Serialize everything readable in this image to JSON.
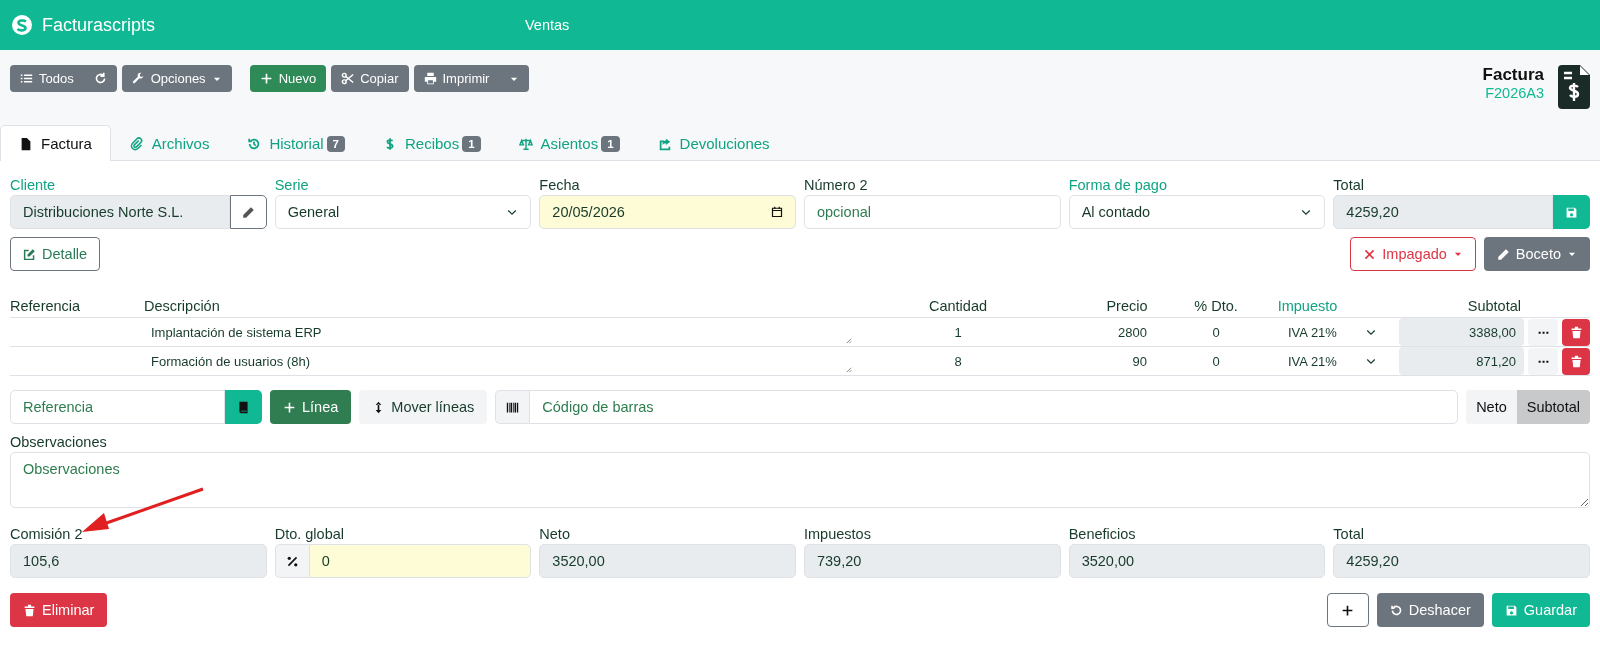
{
  "app": {
    "name": "Facturascripts",
    "section": "Ventas"
  },
  "toolbar": {
    "all": "Todos",
    "options": "Opciones",
    "new": "Nuevo",
    "copy": "Copiar",
    "print": "Imprimir"
  },
  "document": {
    "type": "Factura",
    "code": "F2026A3"
  },
  "tabs": [
    {
      "label": "Factura",
      "selected": true
    },
    {
      "label": "Archivos",
      "selected": false
    },
    {
      "label": "Historial",
      "badge": "7",
      "selected": false
    },
    {
      "label": "Recibos",
      "badge": "1",
      "selected": false
    },
    {
      "label": "Asientos",
      "badge": "1",
      "selected": false
    },
    {
      "label": "Devoluciones",
      "selected": false
    }
  ],
  "fields": [
    {
      "kind": "client",
      "label": "Cliente",
      "linked": true,
      "value": "Distribuciones Norte S.L."
    },
    {
      "kind": "select",
      "label": "Serie",
      "linked": true,
      "value": "General"
    },
    {
      "kind": "date",
      "label": "Fecha",
      "linked": false,
      "value": "20/05/2026"
    },
    {
      "kind": "text",
      "label": "Número 2",
      "linked": false,
      "placeholder": "opcional"
    },
    {
      "kind": "select",
      "label": "Forma de pago",
      "linked": true,
      "value": "Al contado"
    },
    {
      "kind": "total",
      "label": "Total",
      "linked": false,
      "value": "4259,20"
    }
  ],
  "detail": "Detalle",
  "payment_status": "Impagado",
  "state_menu": "Boceto",
  "lines": {
    "columns": [
      {
        "label": "Referencia",
        "linked": false
      },
      {
        "label": "Descripción",
        "linked": false
      },
      {
        "label": "Cantidad",
        "linked": false
      },
      {
        "label": "Precio",
        "linked": false
      },
      {
        "label": "% Dto.",
        "linked": false
      },
      {
        "label": "Impuesto",
        "linked": true
      },
      {
        "label": "Subtotal",
        "linked": false
      }
    ],
    "rows": [
      {
        "description": "Implantación de sistema ERP",
        "quantity": "1",
        "price": "2800",
        "discount": "0",
        "tax": "IVA 21%",
        "subtotal": "3388,00"
      },
      {
        "description": "Formación de usuarios (8h)",
        "quantity": "8",
        "price": "90",
        "discount": "0",
        "tax": "IVA 21%",
        "subtotal": "871,20"
      }
    ]
  },
  "line_tools": {
    "reference_placeholder": "Referencia",
    "add_line": "Línea",
    "move_lines": "Mover líneas",
    "barcode_placeholder": "Código de barras",
    "view_toggle": [
      {
        "label": "Neto",
        "selected": false
      },
      {
        "label": "Subtotal",
        "selected": true
      }
    ]
  },
  "notes": {
    "label": "Observaciones",
    "placeholder": "Observaciones"
  },
  "totals": [
    {
      "kind": "readonly",
      "label": "Comisión 2",
      "value": "105,6"
    },
    {
      "kind": "discount",
      "label": "Dto. global",
      "value": "0"
    },
    {
      "kind": "readonly",
      "label": "Neto",
      "value": "3520,00"
    },
    {
      "kind": "readonly",
      "label": "Impuestos",
      "value": "739,20"
    },
    {
      "kind": "readonly",
      "label": "Beneficios",
      "value": "3520,00"
    },
    {
      "kind": "readonly",
      "label": "Total",
      "value": "4259,20"
    }
  ],
  "actions": {
    "delete": "Eliminar",
    "undo": "Deshacer",
    "save": "Guardar"
  }
}
